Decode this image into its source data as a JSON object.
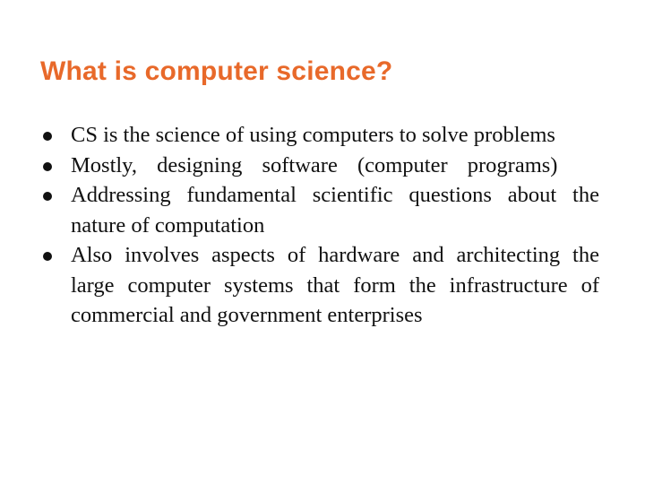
{
  "slide": {
    "title": "What is computer science?",
    "title_color": "#E8692A",
    "bullet_icon": "bullet-dot-icon",
    "bullets": [
      {
        "text": "CS is the science of using computers to  solve problems"
      },
      {
        "text": "Mostly, designing software (computer programs)"
      },
      {
        "text": "Addressing fundamental scientific questions  about the nature of computation"
      },
      {
        "text": "Also involves aspects of hardware and  architecting the large computer systems that  form the infrastructure of commercial and  government enterprises"
      }
    ]
  }
}
